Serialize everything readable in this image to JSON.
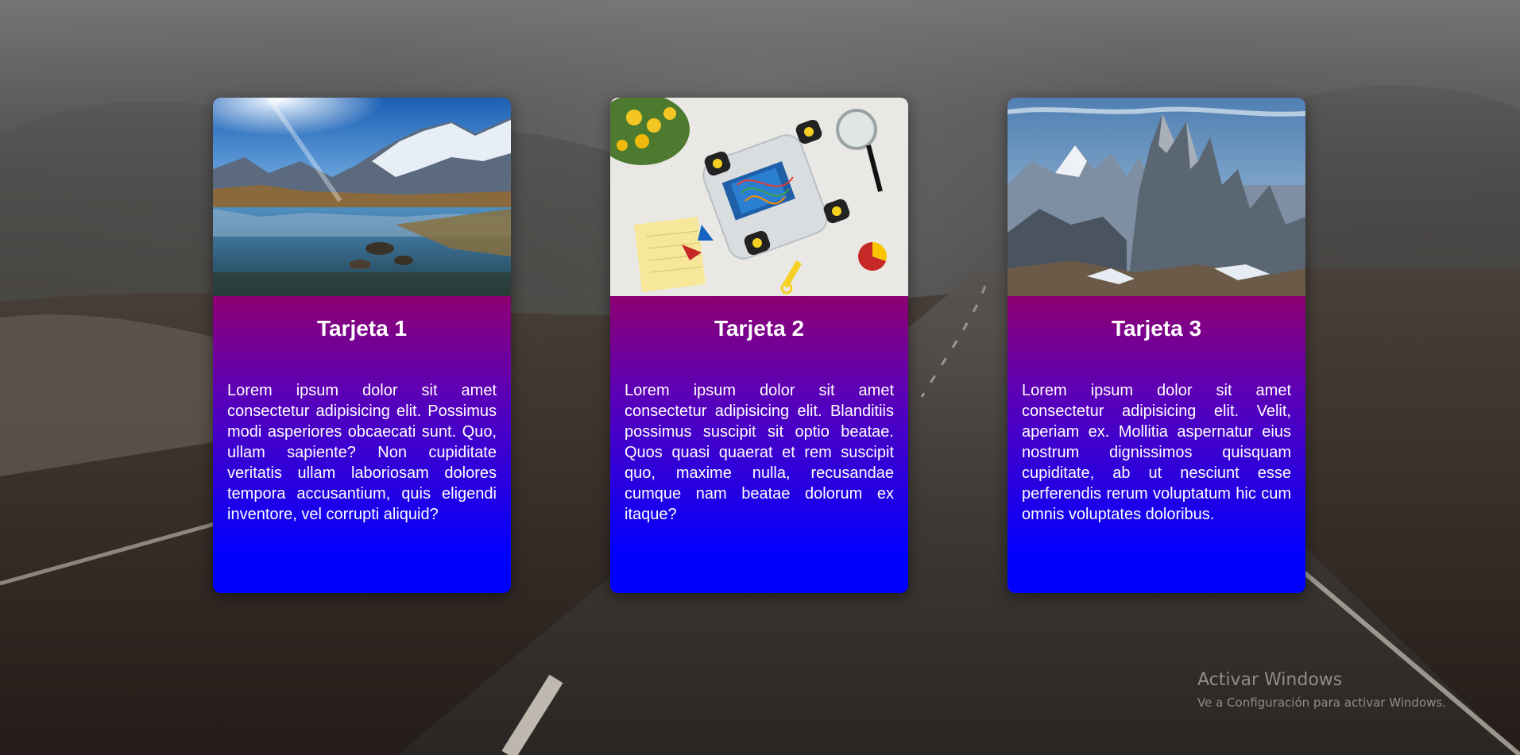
{
  "cards": [
    {
      "title": "Tarjeta 1",
      "text": "Lorem ipsum dolor sit amet consectetur adipisicing elit. Possimus modi asperiores obcaecati sunt. Quo, ullam sapiente? Non cupiditate veritatis ullam laboriosam dolores tempora accusantium, quis eligendi inventore, vel corrupti aliquid?",
      "image": "mountain-lake-photo"
    },
    {
      "title": "Tarjeta 2",
      "text": "Lorem ipsum dolor sit amet consectetur adipisicing elit. Blanditiis possimus suscipit sit optio beatae. Quos quasi quaerat et rem suscipit quo, maxime nulla, recusandae cumque nam beatae dolorum ex itaque?",
      "image": "robot-car-kit-photo"
    },
    {
      "title": "Tarjeta 3",
      "text": "Lorem ipsum dolor sit amet consectetur adipisicing elit. Velit, aperiam ex. Mollitia aspernatur eius nostrum dignissimos quisquam cupiditate, ab ut nesciunt esse perferendis rerum voluptatum hic cum omnis voluptates doloribus.",
      "image": "rocky-peaks-photo"
    }
  ],
  "card_gradient": {
    "top": "#ff0000",
    "bottom": "#0000ff"
  },
  "watermark": {
    "title": "Activar Windows",
    "subtitle": "Ve a Configuración para activar Windows."
  }
}
